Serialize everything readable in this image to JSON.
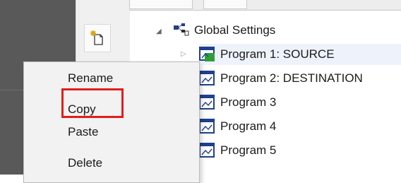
{
  "toolbar": {
    "new_icon": "new-item-icon"
  },
  "tree": {
    "root": {
      "label": "Global Settings",
      "icon": "global-settings-icon",
      "expanded": true
    },
    "items": [
      {
        "label": "Program 1: SOURCE",
        "icon": "program-active-icon",
        "selected": true
      },
      {
        "label": "Program 2: DESTINATION",
        "icon": "program-icon"
      },
      {
        "label": "Program 3",
        "icon": "program-icon"
      },
      {
        "label": "Program 4",
        "icon": "program-icon"
      },
      {
        "label": "Program 5",
        "icon": "program-icon"
      }
    ]
  },
  "context_menu": {
    "items": [
      {
        "label": "Rename"
      },
      {
        "label": "Copy",
        "highlighted": true
      },
      {
        "label": "Paste"
      },
      {
        "label": "Delete"
      }
    ]
  },
  "colors": {
    "highlight_border": "#e31c1c",
    "icon_blue": "#1f3f8f",
    "icon_green": "#2e9e3a"
  }
}
